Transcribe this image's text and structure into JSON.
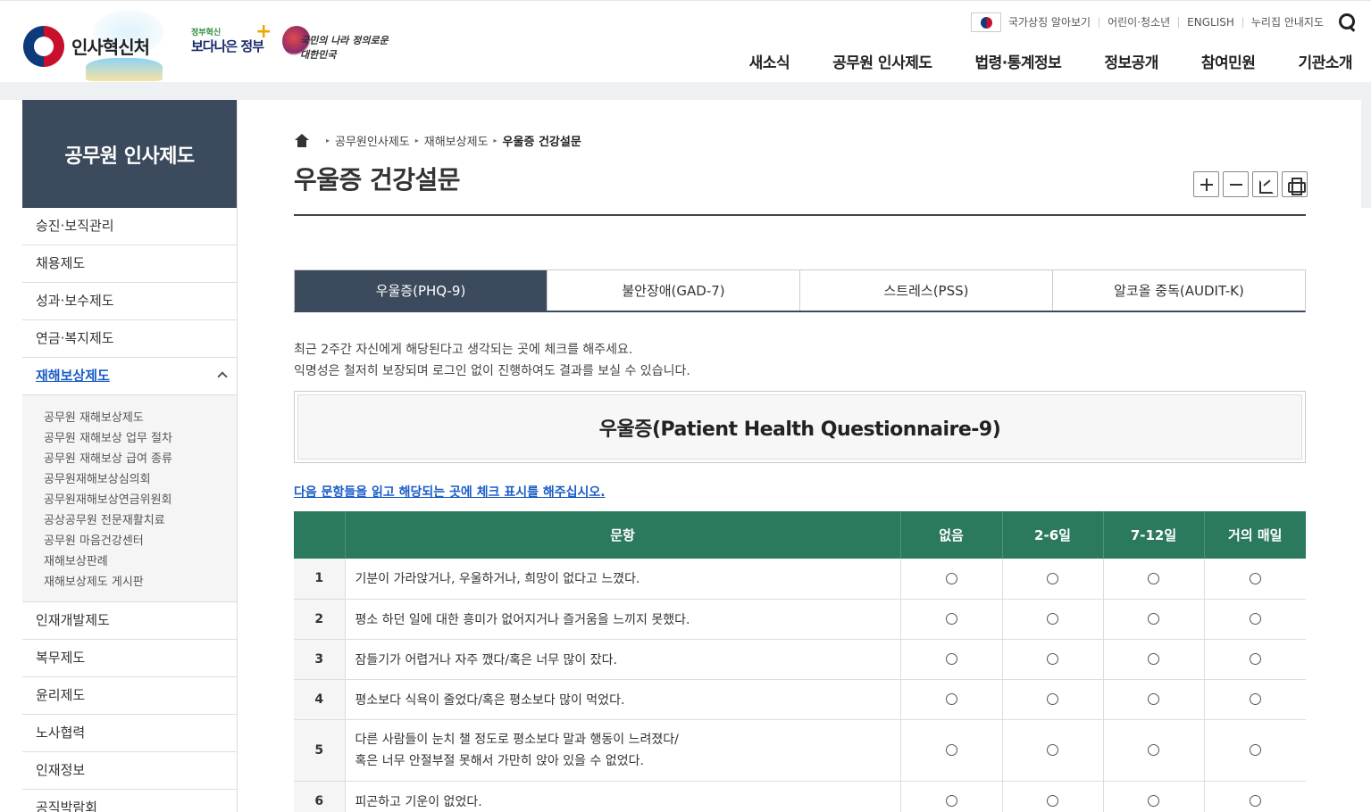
{
  "header": {
    "logo_title": "인사혁신처",
    "gov_small": "정부혁신",
    "gov_big": "보다나은 정부",
    "nation_slogan": "국민의 나라 정의로운 대한민국",
    "utility": [
      "국가상징 알아보기",
      "어린이·청소년",
      "ENGLISH",
      "누리집 안내지도"
    ],
    "gnb": [
      "새소식",
      "공무원 인사제도",
      "법령·통계정보",
      "정보공개",
      "참여민원",
      "기관소개"
    ]
  },
  "sidebar": {
    "title": "공무원 인사제도",
    "items_top": [
      "승진·보직관리",
      "채용제도",
      "성과·보수제도",
      "연금·복지제도"
    ],
    "active": "재해보상제도",
    "sub_items": [
      "공무원 재해보상제도",
      "공무원 재해보상 업무 절차",
      "공무원 재해보상 급여 종류",
      "공무원재해보상심의회",
      "공무원재해보상연금위원회",
      "공상공무원 전문재활치료",
      "공무원 마음건강센터",
      "재해보상판례",
      "재해보상제도 게시판"
    ],
    "items_bottom": [
      "인재개발제도",
      "복무제도",
      "윤리제도",
      "노사협력",
      "인재정보",
      "공직박람회"
    ]
  },
  "breadcrumb": {
    "items": [
      "공무원인사제도",
      "재해보상제도"
    ],
    "current": "우울증 건강설문"
  },
  "page_title": "우울증 건강설문",
  "tabs": [
    "우울증(PHQ-9)",
    "불안장애(GAD-7)",
    "스트레스(PSS)",
    "알코올 중독(AUDIT-K)"
  ],
  "intro": {
    "line1": "최근 2주간 자신에게 해당된다고 생각되는 곳에 체크를 해주세요.",
    "line2": "익명성은 철저히 보장되며 로그인 없이 진행하여도 결과를 보실 수 있습니다."
  },
  "questionnaire_title": "우울증(Patient Health Questionnaire-9)",
  "instruction": "다음 문항들을 읽고 해당되는 곳에 체크 표시를 해주십시오.",
  "table": {
    "headers": [
      "문항",
      "없음",
      "2-6일",
      "7-12일",
      "거의 매일"
    ],
    "rows": [
      {
        "no": "1",
        "text": "기분이 가라앉거나, 우울하거나, 희망이 없다고 느꼈다."
      },
      {
        "no": "2",
        "text": "평소 하던 일에 대한 흥미가 없어지거나 즐거움을 느끼지 못했다."
      },
      {
        "no": "3",
        "text": "잠들기가 어렵거나 자주 깼다/혹은 너무 많이 잤다."
      },
      {
        "no": "4",
        "text": "평소보다 식욕이 줄었다/혹은 평소보다 많이 먹었다."
      },
      {
        "no": "5",
        "text": "다른 사람들이 눈치 챌 정도로 평소보다 말과 행동이 느려졌다/",
        "text2": "혹은 너무 안절부절 못해서 가만히 앉아 있을 수 없었다."
      },
      {
        "no": "6",
        "text": "피곤하고 기운이 없었다."
      }
    ]
  },
  "colors": {
    "sidebar_head": "#3b4a5c",
    "table_header": "#2b7a5e",
    "active_link": "#1a5cc6"
  }
}
